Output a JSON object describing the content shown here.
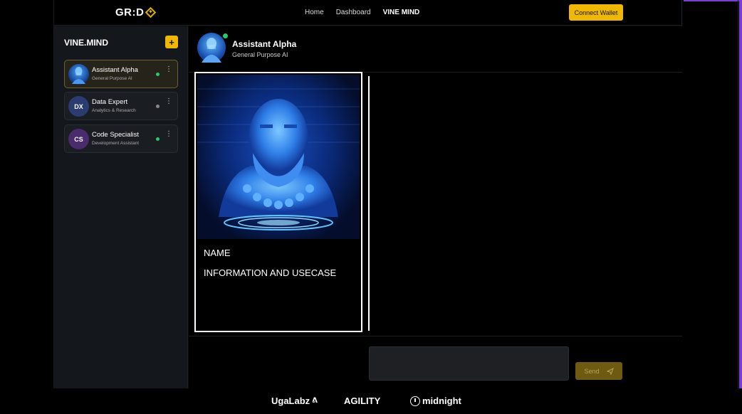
{
  "topbar": {
    "logo": "GR:D",
    "nav": [
      "Home",
      "Dashboard",
      "VINE MIND"
    ],
    "active_nav": "VINE MIND",
    "connect_wallet": "Connect Wallet"
  },
  "sidebar": {
    "title": "VINE.MIND",
    "add_label": "+",
    "agents": [
      {
        "name": "Assistant Alpha",
        "subtitle": "General Purpose AI",
        "avatar": "hologram-avatar",
        "status": "online",
        "selected": true
      },
      {
        "name": "Data Expert",
        "subtitle": "Analytics & Research",
        "initials": "DX",
        "status": "offline",
        "selected": false
      },
      {
        "name": "Code Specialist",
        "subtitle": "Development Assistant",
        "initials": "CS",
        "status": "online",
        "selected": false
      }
    ]
  },
  "chat": {
    "title": "Assistant Alpha",
    "subtitle": "General Purpose AI",
    "status": "online",
    "card": {
      "name_label": "NAME",
      "info_label": "INFORMATION AND USECASE"
    },
    "input_value": "",
    "send_label": "Send"
  },
  "footer": {
    "partners": [
      "UgaLabz",
      "AGILITY",
      "midnight"
    ]
  },
  "colors": {
    "accent": "#f0b800",
    "online": "#22cc66",
    "offline": "#888888",
    "frame": "#7a3bd6"
  }
}
